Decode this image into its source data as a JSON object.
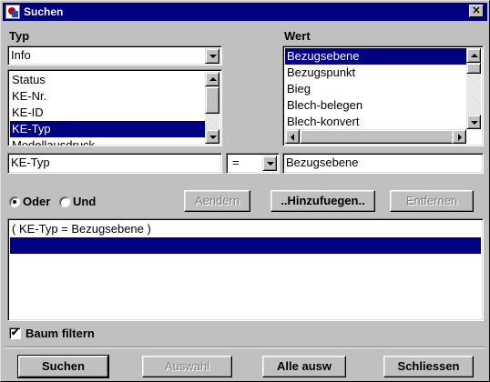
{
  "window": {
    "title": "Suchen",
    "close_glyph": "✕"
  },
  "typ": {
    "label": "Typ",
    "combo_value": "Info",
    "list_items": [
      "Status",
      "KE-Nr.",
      "KE-ID",
      "KE-Typ",
      "Modellausdruck"
    ],
    "selected_index": 3
  },
  "wert": {
    "label": "Wert",
    "list_items": [
      "Bezugsebene",
      "Bezugspunkt",
      "Bieg",
      "Blech-belegen",
      "Blech-konvert"
    ],
    "selected_index": 0
  },
  "condition": {
    "field_value": "KE-Typ",
    "operator_value": "=",
    "value_value": "Bezugsebene"
  },
  "logic": {
    "oder_label": "Oder",
    "und_label": "Und",
    "selected": "Oder"
  },
  "actions": {
    "aendern_label": "Aendern",
    "hinzufuegen_label": "..Hinzufuegen..",
    "entfernen_label": "Entfernen"
  },
  "criteria": {
    "items": [
      "( KE-Typ = Bezugsebene )",
      ""
    ],
    "selected_index": 1
  },
  "filter": {
    "label": "Baum filtern",
    "checked": true,
    "check_glyph": "✔"
  },
  "footer": {
    "suchen_label": "Suchen",
    "auswahl_label": "Auswahl",
    "alle_auswahl_label": "Alle ausw",
    "schliessen_label": "Schliessen"
  },
  "colors": {
    "title_bar": "#000080",
    "selection": "#000080",
    "face": "#c0c0c0"
  }
}
